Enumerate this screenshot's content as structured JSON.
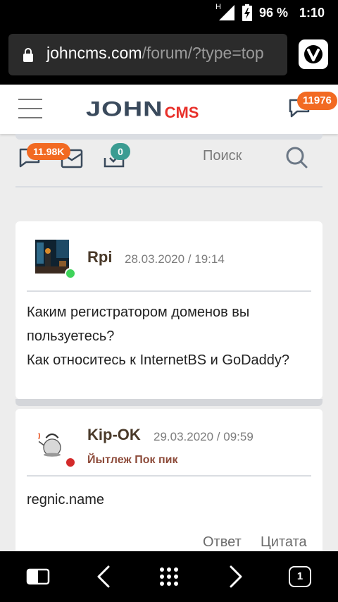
{
  "status_bar": {
    "network": "H",
    "battery_percent": "96 %",
    "time": "1:10"
  },
  "browser": {
    "url_host": "johncms.com",
    "url_path": "/forum/?type=top"
  },
  "site_header": {
    "logo_main": "JOHN",
    "logo_accent": "CMS",
    "messages_badge": "11976"
  },
  "counters": {
    "forum_badge": "11.98K",
    "mail_badge": "",
    "check_badge": "0",
    "search_label": "Поиск"
  },
  "posts": [
    {
      "username": "Rpi",
      "date": "28.03.2020 / 19:14",
      "status": "",
      "online": true,
      "lines": [
        "Каким регистратором доменов вы",
        "пользуетесь?",
        "Как относитесь к InternetBS и GoDaddy?"
      ]
    },
    {
      "username": "Kip-OK",
      "date": "29.03.2020 / 09:59",
      "status": "Йытлеж Пок пик",
      "online": false,
      "lines": [
        "regnic.name"
      ],
      "reply_label": "Ответ",
      "quote_label": "Цитата"
    }
  ],
  "colors": {
    "accent_orange": "#f26a22",
    "badge_teal": "#3b9c92",
    "online_green": "#3fd35a",
    "offline_red": "#d32a2a"
  },
  "bottom_nav": {
    "tabs_count": "1"
  }
}
